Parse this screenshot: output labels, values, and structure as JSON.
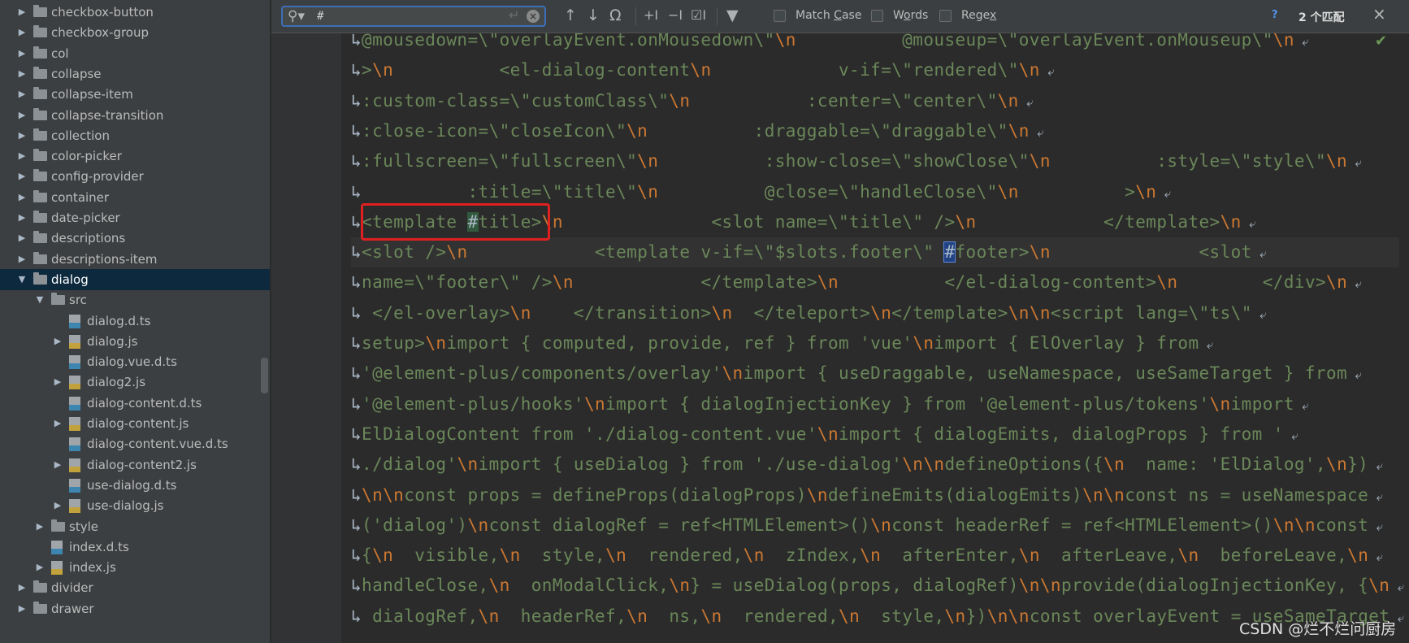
{
  "find": {
    "query": "#",
    "options": [
      {
        "label": "Match Case",
        "mnemonic": "C"
      },
      {
        "label": "Words",
        "mnemonic": "o"
      },
      {
        "label": "Regex",
        "mnemonic": "x"
      }
    ],
    "help": "?",
    "match_count": "2 个匹配",
    "close": "×"
  },
  "tree": [
    {
      "label": "checkbox-button",
      "level": 0,
      "type": "folder",
      "arrow": "▶"
    },
    {
      "label": "checkbox-group",
      "level": 0,
      "type": "folder",
      "arrow": "▶"
    },
    {
      "label": "col",
      "level": 0,
      "type": "folder",
      "arrow": "▶"
    },
    {
      "label": "collapse",
      "level": 0,
      "type": "folder",
      "arrow": "▶"
    },
    {
      "label": "collapse-item",
      "level": 0,
      "type": "folder",
      "arrow": "▶"
    },
    {
      "label": "collapse-transition",
      "level": 0,
      "type": "folder",
      "arrow": "▶"
    },
    {
      "label": "collection",
      "level": 0,
      "type": "folder",
      "arrow": "▶"
    },
    {
      "label": "color-picker",
      "level": 0,
      "type": "folder",
      "arrow": "▶"
    },
    {
      "label": "config-provider",
      "level": 0,
      "type": "folder",
      "arrow": "▶"
    },
    {
      "label": "container",
      "level": 0,
      "type": "folder",
      "arrow": "▶"
    },
    {
      "label": "date-picker",
      "level": 0,
      "type": "folder",
      "arrow": "▶"
    },
    {
      "label": "descriptions",
      "level": 0,
      "type": "folder",
      "arrow": "▶"
    },
    {
      "label": "descriptions-item",
      "level": 0,
      "type": "folder",
      "arrow": "▶"
    },
    {
      "label": "dialog",
      "level": 0,
      "type": "folder",
      "arrow": "▼",
      "selected": true
    },
    {
      "label": "src",
      "level": 1,
      "type": "folder",
      "arrow": "▼"
    },
    {
      "label": "dialog.d.ts",
      "level": 2,
      "type": "ts",
      "arrow": ""
    },
    {
      "label": "dialog.js",
      "level": 2,
      "type": "js",
      "arrow": "▶"
    },
    {
      "label": "dialog.vue.d.ts",
      "level": 2,
      "type": "ts",
      "arrow": ""
    },
    {
      "label": "dialog2.js",
      "level": 2,
      "type": "js",
      "arrow": "▶"
    },
    {
      "label": "dialog-content.d.ts",
      "level": 2,
      "type": "ts",
      "arrow": ""
    },
    {
      "label": "dialog-content.js",
      "level": 2,
      "type": "js",
      "arrow": "▶"
    },
    {
      "label": "dialog-content.vue.d.ts",
      "level": 2,
      "type": "ts",
      "arrow": ""
    },
    {
      "label": "dialog-content2.js",
      "level": 2,
      "type": "js",
      "arrow": "▶"
    },
    {
      "label": "use-dialog.d.ts",
      "level": 2,
      "type": "ts",
      "arrow": ""
    },
    {
      "label": "use-dialog.js",
      "level": 2,
      "type": "js",
      "arrow": "▶"
    },
    {
      "label": "style",
      "level": 1,
      "type": "folder",
      "arrow": "▶"
    },
    {
      "label": "index.d.ts",
      "level": 1,
      "type": "ts",
      "arrow": ""
    },
    {
      "label": "index.js",
      "level": 1,
      "type": "js",
      "arrow": "▶"
    },
    {
      "label": "divider",
      "level": 0,
      "type": "folder",
      "arrow": "▶"
    },
    {
      "label": "drawer",
      "level": 0,
      "type": "folder",
      "arrow": "▶"
    }
  ],
  "code_lines": [
    [
      {
        "t": "@mousedown=\\\"overlayEvent.onMousedown\\\"",
        "c": "s"
      },
      {
        "t": "\\n          ",
        "c": "k"
      },
      {
        "t": "@mouseup=\\\"overlayEvent.onMouseup\\\"",
        "c": "s"
      },
      {
        "t": "\\n",
        "c": "k"
      }
    ],
    [
      {
        "t": ">",
        "c": "s"
      },
      {
        "t": "\\n          ",
        "c": "k"
      },
      {
        "t": "<el-dialog-content",
        "c": "s"
      },
      {
        "t": "\\n            ",
        "c": "k"
      },
      {
        "t": "v-if=\\\"rendered\\\"",
        "c": "s"
      },
      {
        "t": "\\n",
        "c": "k"
      }
    ],
    [
      {
        "t": ":custom-class=\\\"customClass\\\"",
        "c": "s"
      },
      {
        "t": "\\n           ",
        "c": "k"
      },
      {
        "t": ":center=\\\"center\\\"",
        "c": "s"
      },
      {
        "t": "\\n",
        "c": "k"
      }
    ],
    [
      {
        "t": ":close-icon=\\\"closeIcon\\\"",
        "c": "s"
      },
      {
        "t": "\\n          ",
        "c": "k"
      },
      {
        "t": ":draggable=\\\"draggable\\\"",
        "c": "s"
      },
      {
        "t": "\\n",
        "c": "k"
      }
    ],
    [
      {
        "t": ":fullscreen=\\\"fullscreen\\\"",
        "c": "s"
      },
      {
        "t": "\\n          ",
        "c": "k"
      },
      {
        "t": ":show-close=\\\"showClose\\\"",
        "c": "s"
      },
      {
        "t": "\\n          ",
        "c": "k"
      },
      {
        "t": ":style=\\\"style\\\"",
        "c": "s"
      },
      {
        "t": "\\n",
        "c": "k"
      }
    ],
    [
      {
        "t": "          :title=\\\"title\\\"",
        "c": "s"
      },
      {
        "t": "\\n          ",
        "c": "k"
      },
      {
        "t": "@close=\\\"handleClose\\\"",
        "c": "s"
      },
      {
        "t": "\\n          ",
        "c": "k"
      },
      {
        "t": ">",
        "c": "s"
      },
      {
        "t": "\\n",
        "c": "k"
      }
    ],
    [
      {
        "t": "<template ",
        "c": "s"
      },
      {
        "t": "#",
        "c": "hl"
      },
      {
        "t": "title>",
        "c": "s"
      },
      {
        "t": "\\n",
        "c": "k"
      },
      {
        "t": "              ",
        "c": "s"
      },
      {
        "t": "<slot name=\\\"title\\\" />",
        "c": "s"
      },
      {
        "t": "\\n            ",
        "c": "k"
      },
      {
        "t": "</template>",
        "c": "s"
      },
      {
        "t": "\\n",
        "c": "k"
      }
    ],
    [
      {
        "t": "<slot />",
        "c": "s"
      },
      {
        "t": "\\n            ",
        "c": "k"
      },
      {
        "t": "<template v-if=\\\"$slots.footer\\\" ",
        "c": "s"
      },
      {
        "t": "#",
        "c": "hlsel"
      },
      {
        "t": "footer>",
        "c": "s"
      },
      {
        "t": "\\n              ",
        "c": "k"
      },
      {
        "t": "<slot",
        "c": "s"
      }
    ],
    [
      {
        "t": "name=\\\"footer\\\" />",
        "c": "s"
      },
      {
        "t": "\\n            ",
        "c": "k"
      },
      {
        "t": "</template>",
        "c": "s"
      },
      {
        "t": "\\n          ",
        "c": "k"
      },
      {
        "t": "</el-dialog-content>",
        "c": "s"
      },
      {
        "t": "\\n        ",
        "c": "k"
      },
      {
        "t": "</div>",
        "c": "s"
      },
      {
        "t": "\\n",
        "c": "k"
      }
    ],
    [
      {
        "t": " </el-overlay>",
        "c": "s"
      },
      {
        "t": "\\n    ",
        "c": "k"
      },
      {
        "t": "</transition>",
        "c": "s"
      },
      {
        "t": "\\n  ",
        "c": "k"
      },
      {
        "t": "</teleport>",
        "c": "s"
      },
      {
        "t": "\\n",
        "c": "k"
      },
      {
        "t": "</template>",
        "c": "s"
      },
      {
        "t": "\\n\\n",
        "c": "k"
      },
      {
        "t": "<script lang=\\\"ts\\\"",
        "c": "s"
      }
    ],
    [
      {
        "t": "setup>",
        "c": "s"
      },
      {
        "t": "\\n",
        "c": "k"
      },
      {
        "t": "import { computed, provide, ref } from 'vue'",
        "c": "s"
      },
      {
        "t": "\\n",
        "c": "k"
      },
      {
        "t": "import { ElOverlay } from",
        "c": "s"
      }
    ],
    [
      {
        "t": "'@element-plus/components/overlay'",
        "c": "s"
      },
      {
        "t": "\\n",
        "c": "k"
      },
      {
        "t": "import { useDraggable, useNamespace, useSameTarget } from",
        "c": "s"
      }
    ],
    [
      {
        "t": "'@element-plus/hooks'",
        "c": "s"
      },
      {
        "t": "\\n",
        "c": "k"
      },
      {
        "t": "import { dialogInjectionKey } from '@element-plus/tokens'",
        "c": "s"
      },
      {
        "t": "\\n",
        "c": "k"
      },
      {
        "t": "import",
        "c": "s"
      }
    ],
    [
      {
        "t": "ElDialogContent from './dialog-content.vue'",
        "c": "s"
      },
      {
        "t": "\\n",
        "c": "k"
      },
      {
        "t": "import { dialogEmits, dialogProps } from '",
        "c": "s"
      }
    ],
    [
      {
        "t": "./dialog'",
        "c": "s"
      },
      {
        "t": "\\n",
        "c": "k"
      },
      {
        "t": "import { useDialog } from './use-dialog'",
        "c": "s"
      },
      {
        "t": "\\n\\n",
        "c": "k"
      },
      {
        "t": "defineOptions({",
        "c": "s"
      },
      {
        "t": "\\n",
        "c": "k"
      },
      {
        "t": "  name: 'ElDialog',",
        "c": "s"
      },
      {
        "t": "\\n",
        "c": "k"
      },
      {
        "t": "})",
        "c": "s"
      }
    ],
    [
      {
        "t": "\\n\\n",
        "c": "k"
      },
      {
        "t": "const props = defineProps(dialogProps)",
        "c": "s"
      },
      {
        "t": "\\n",
        "c": "k"
      },
      {
        "t": "defineEmits(dialogEmits)",
        "c": "s"
      },
      {
        "t": "\\n\\n",
        "c": "k"
      },
      {
        "t": "const ns = useNamespace",
        "c": "s"
      }
    ],
    [
      {
        "t": "('dialog')",
        "c": "s"
      },
      {
        "t": "\\n",
        "c": "k"
      },
      {
        "t": "const dialogRef = ref<HTMLElement>()",
        "c": "s"
      },
      {
        "t": "\\n",
        "c": "k"
      },
      {
        "t": "const headerRef = ref<HTMLElement>()",
        "c": "s"
      },
      {
        "t": "\\n\\n",
        "c": "k"
      },
      {
        "t": "const",
        "c": "s"
      }
    ],
    [
      {
        "t": "{",
        "c": "s"
      },
      {
        "t": "\\n",
        "c": "k"
      },
      {
        "t": "  visible,",
        "c": "s"
      },
      {
        "t": "\\n",
        "c": "k"
      },
      {
        "t": "  style,",
        "c": "s"
      },
      {
        "t": "\\n",
        "c": "k"
      },
      {
        "t": "  rendered,",
        "c": "s"
      },
      {
        "t": "\\n",
        "c": "k"
      },
      {
        "t": "  zIndex,",
        "c": "s"
      },
      {
        "t": "\\n",
        "c": "k"
      },
      {
        "t": "  afterEnter,",
        "c": "s"
      },
      {
        "t": "\\n",
        "c": "k"
      },
      {
        "t": "  afterLeave,",
        "c": "s"
      },
      {
        "t": "\\n",
        "c": "k"
      },
      {
        "t": "  beforeLeave,",
        "c": "s"
      },
      {
        "t": "\\n",
        "c": "k"
      }
    ],
    [
      {
        "t": "handleClose,",
        "c": "s"
      },
      {
        "t": "\\n",
        "c": "k"
      },
      {
        "t": "  onModalClick,",
        "c": "s"
      },
      {
        "t": "\\n",
        "c": "k"
      },
      {
        "t": "} = useDialog(props, dialogRef)",
        "c": "s"
      },
      {
        "t": "\\n\\n",
        "c": "k"
      },
      {
        "t": "provide(dialogInjectionKey, {",
        "c": "s"
      },
      {
        "t": "\\n",
        "c": "k"
      }
    ],
    [
      {
        "t": " dialogRef,",
        "c": "s"
      },
      {
        "t": "\\n",
        "c": "k"
      },
      {
        "t": "  headerRef,",
        "c": "s"
      },
      {
        "t": "\\n",
        "c": "k"
      },
      {
        "t": "  ns,",
        "c": "s"
      },
      {
        "t": "\\n",
        "c": "k"
      },
      {
        "t": "  rendered,",
        "c": "s"
      },
      {
        "t": "\\n",
        "c": "k"
      },
      {
        "t": "  style,",
        "c": "s"
      },
      {
        "t": "\\n",
        "c": "k"
      },
      {
        "t": "})",
        "c": "s"
      },
      {
        "t": "\\n\\n",
        "c": "k"
      },
      {
        "t": "const overlayEvent = useSameTarget",
        "c": "s"
      }
    ]
  ],
  "watermark": "CSDN @烂不烂问厨房"
}
